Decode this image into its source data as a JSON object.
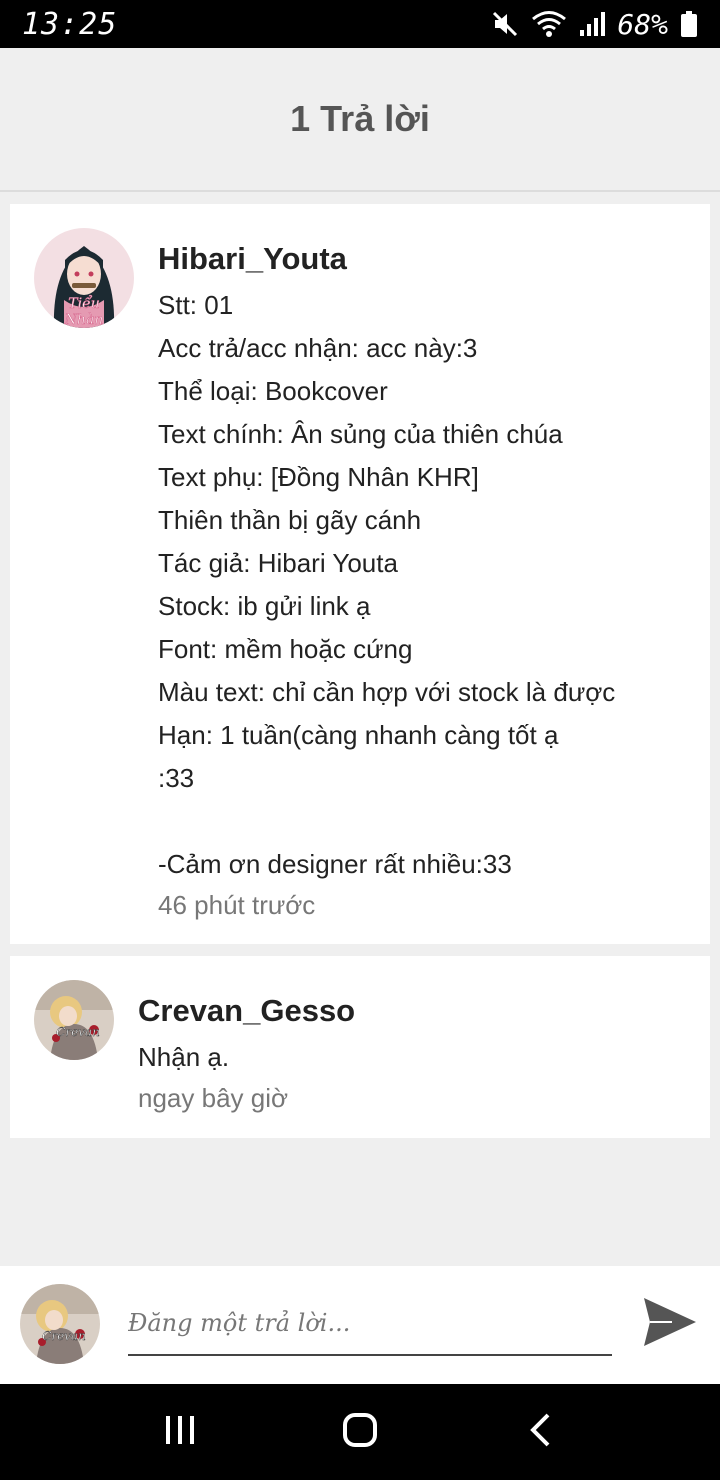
{
  "status_bar": {
    "time": "13:25",
    "battery": "68%",
    "icons": [
      "mute-icon",
      "wifi-icon",
      "signal-icon",
      "battery-icon"
    ]
  },
  "header": {
    "title": "1 Trả lời"
  },
  "comments": [
    {
      "username": "Hibari_Youta",
      "lines": [
        "Stt: 01",
        "Acc trả/acc nhận: acc này:3",
        "Thể loại: Bookcover",
        "Text chính: Ân sủng của thiên chúa",
        "Text phụ: [Đồng Nhân KHR]",
        "Thiên thần bị gãy cánh",
        "Tác giả: Hibari Youta",
        "Stock: ib gửi link ạ",
        "Font: mềm hoặc cứng",
        "Màu text: chỉ cần hợp với stock là được",
        "Hạn: 1 tuần(càng nhanh càng tốt ạ",
        ":33",
        "",
        "-Cảm ơn designer rất nhiều:33"
      ],
      "time": "46 phút trước"
    },
    {
      "username": "Crevan_Gesso",
      "lines": [
        "Nhận ạ."
      ],
      "time": "ngay bây giờ"
    }
  ],
  "reply_bar": {
    "placeholder": "Đăng một trả lời...",
    "send_icon": "send-icon"
  },
  "nav_bar": {
    "icons": [
      "recent-apps-icon",
      "home-icon",
      "back-icon"
    ]
  },
  "colors": {
    "background": "#efefef",
    "card": "#ffffff",
    "title": "#555555",
    "muted": "#777777"
  }
}
